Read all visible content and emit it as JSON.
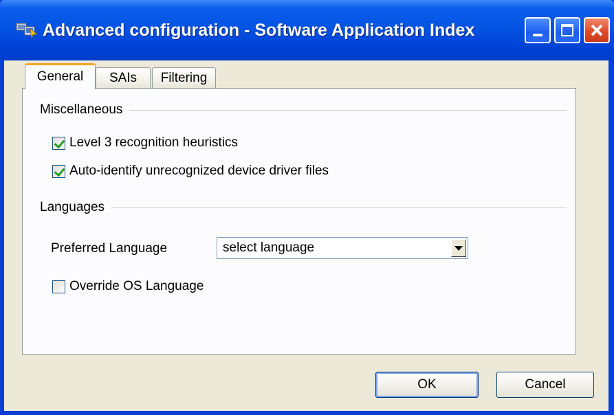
{
  "window": {
    "title": "Advanced configuration - Software Application Index",
    "icon": "sai-app-icon"
  },
  "title_buttons": {
    "minimize_icon": "minimize-icon",
    "maximize_icon": "maximize-icon",
    "close_icon": "close-icon"
  },
  "tabs": [
    {
      "label": "General",
      "active": true
    },
    {
      "label": "SAIs",
      "active": false
    },
    {
      "label": "Filtering",
      "active": false
    }
  ],
  "miscellaneous": {
    "heading": "Miscellaneous",
    "options": [
      {
        "label": "Level 3 recognition heuristics",
        "checked": true
      },
      {
        "label": "Auto-identify unrecognized device driver files",
        "checked": true
      }
    ]
  },
  "languages": {
    "heading": "Languages",
    "preferred_label": "Preferred Language",
    "preferred_value": "select language",
    "override_label": "Override OS Language",
    "override_checked": false
  },
  "footer": {
    "ok_label": "OK",
    "cancel_label": "Cancel"
  },
  "colors": {
    "titlebar": "#0454e3",
    "client_bg": "#ece9d8",
    "active_tab_accent": "#f5a623",
    "check_green": "#21a121",
    "close_red": "#de4b2a"
  }
}
